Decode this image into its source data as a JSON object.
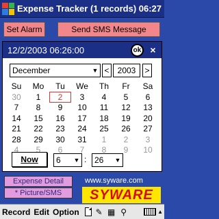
{
  "titlebar": {
    "title": "Expense Tracker (1 records)",
    "time": "06:27"
  },
  "buttons": {
    "set_alarm": "Set Alarm",
    "send_sms": "Send SMS Message"
  },
  "calendar": {
    "datetime": "12/2/2003 06:26:00",
    "ok_label": "ok",
    "close_label": "×",
    "month": "December",
    "year": "2003",
    "prev_label": "<",
    "next_label": ">",
    "weekdays": [
      "Su",
      "Mo",
      "Tu",
      "We",
      "Th",
      "Fr",
      "Sa"
    ],
    "days": [
      [
        "30",
        "1",
        "2",
        "3",
        "4",
        "5",
        "6"
      ],
      [
        "7",
        "8",
        "9",
        "10",
        "11",
        "12",
        "13"
      ],
      [
        "14",
        "15",
        "16",
        "17",
        "18",
        "19",
        "20"
      ],
      [
        "21",
        "22",
        "23",
        "24",
        "25",
        "26",
        "27"
      ],
      [
        "28",
        "29",
        "30",
        "31",
        "1",
        "2",
        "3"
      ],
      [
        "4",
        "5",
        "6",
        "7",
        "8",
        "9",
        "10"
      ]
    ],
    "muted_days": [
      [
        0,
        0
      ],
      [
        4,
        4
      ],
      [
        4,
        5
      ],
      [
        4,
        6
      ],
      [
        5,
        0
      ],
      [
        5,
        1
      ],
      [
        5,
        2
      ],
      [
        5,
        3
      ],
      [
        5,
        4
      ],
      [
        5,
        5
      ],
      [
        5,
        6
      ]
    ],
    "selected_day": [
      0,
      2
    ],
    "now_label": "Now",
    "hour": "6",
    "minute": "26",
    "time_separator": ":"
  },
  "lower": {
    "expense_tab": "Expense Detail",
    "picture_tab": "* Picture/SMS",
    "url": "www.syware.com",
    "brand": "SYWARE"
  },
  "menubar": {
    "record": "Record",
    "edit": "Edit",
    "option": "Option"
  },
  "colors": {
    "titlebar": "#1b2f86",
    "background": "#2a49a8",
    "button": "#f3868a",
    "tab": "#e39be0",
    "brand_bg": "#ffe600",
    "brand_fg": "#d30d0d"
  }
}
